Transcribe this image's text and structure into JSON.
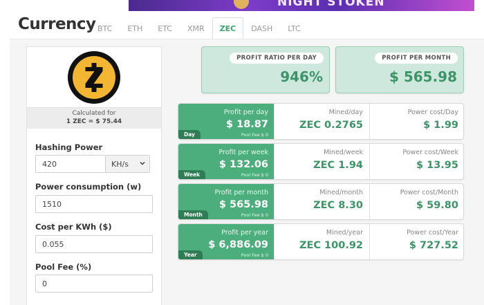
{
  "banner": {
    "text": "NIGHT STOKEN"
  },
  "page": {
    "title": "Currency"
  },
  "tabs": [
    "BTC",
    "ETH",
    "ETC",
    "XMR",
    "ZEC",
    "DASH",
    "LTC"
  ],
  "active_tab": "ZEC",
  "coin": {
    "calc_label": "Calculated for",
    "rate": "1 ZEC = $ 75.44"
  },
  "form": {
    "hashing_power": {
      "label": "Hashing Power",
      "value": "420",
      "unit": "KH/s"
    },
    "power_consumption": {
      "label": "Power consumption (w)",
      "value": "1510"
    },
    "cost_per_kwh": {
      "label": "Cost per KWh ($)",
      "value": "0.055"
    },
    "pool_fee": {
      "label": "Pool Fee (%)",
      "value": "0"
    }
  },
  "summary": {
    "profit_ratio": {
      "label": "PROFIT RATIO PER DAY",
      "value": "946%"
    },
    "profit_month": {
      "label": "PROFIT PER MONTH",
      "value": "$ 565.98"
    }
  },
  "rows": [
    {
      "period": "Day",
      "profit_label": "Profit per day",
      "profit": "$ 18.87",
      "fee": "Pool Fee $ 0",
      "mined_label": "Mined/day",
      "mined": "ZEC 0.2765",
      "power_label": "Power cost/Day",
      "power": "$ 1.99"
    },
    {
      "period": "Week",
      "profit_label": "Profit per week",
      "profit": "$ 132.06",
      "fee": "Pool Fee $ 0",
      "mined_label": "Mined/week",
      "mined": "ZEC 1.94",
      "power_label": "Power cost/Week",
      "power": "$ 13.95"
    },
    {
      "period": "Month",
      "profit_label": "Profit per month",
      "profit": "$ 565.98",
      "fee": "Pool Fee $ 0",
      "mined_label": "Mined/month",
      "mined": "ZEC 8.30",
      "power_label": "Power cost/Month",
      "power": "$ 59.80"
    },
    {
      "period": "Year",
      "profit_label": "Profit per year",
      "profit": "$ 6,886.09",
      "fee": "Pool Fee $ 0",
      "mined_label": "Mined/year",
      "mined": "ZEC 100.92",
      "power_label": "Power cost/Year",
      "power": "$ 727.52"
    }
  ],
  "colors": {
    "accent": "#4dae7d",
    "accent_dark": "#2f7d55",
    "accent_light": "#cfe8dd",
    "logo_gold": "#f2b632"
  }
}
